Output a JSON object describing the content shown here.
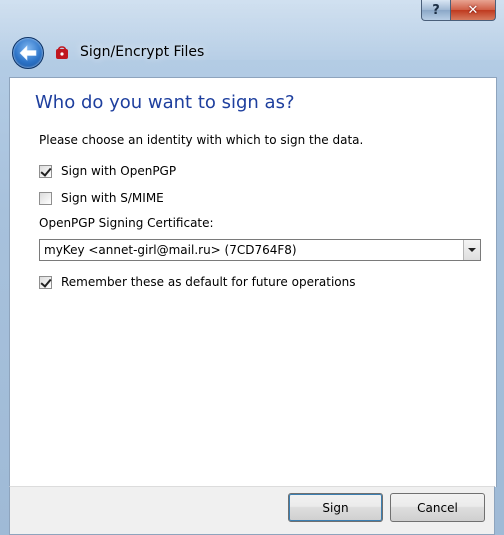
{
  "window": {
    "title": "Sign/Encrypt Files",
    "help_glyph": "?",
    "close_glyph": "✕"
  },
  "page": {
    "heading": "Who do you want to sign as?",
    "intro": "Please choose an identity with which to sign the data.",
    "options": [
      {
        "label": "Sign with OpenPGP",
        "checked": true
      },
      {
        "label": "Sign with S/MIME",
        "checked": false
      }
    ],
    "cert_label": "OpenPGP Signing Certificate:",
    "cert_value": "myKey <annet-girl@mail.ru> (7CD764F8)",
    "remember": {
      "label": "Remember these as default for future operations",
      "checked": true
    }
  },
  "buttons": {
    "sign": "Sign",
    "cancel": "Cancel"
  },
  "colors": {
    "heading": "#1e3f9e",
    "close_button": "#c8462a"
  }
}
